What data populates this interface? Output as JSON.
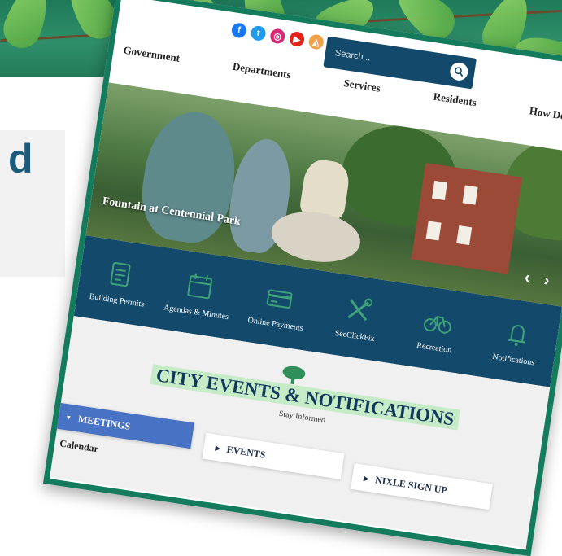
{
  "background": {
    "partial_heading": "d"
  },
  "social": [
    {
      "icon": "facebook-icon",
      "glyph": "f",
      "color": "#1877f2"
    },
    {
      "icon": "twitter-icon",
      "glyph": "t",
      "color": "#1d9bf0"
    },
    {
      "icon": "instagram-icon",
      "glyph": "◎",
      "color": "#d62976"
    },
    {
      "icon": "youtube-icon",
      "glyph": "▶",
      "color": "#e62117"
    },
    {
      "icon": "nixle-icon",
      "glyph": "◭",
      "color": "#f0a24a"
    }
  ],
  "search": {
    "placeholder": "Search..."
  },
  "nav": [
    "Government",
    "Departments",
    "Services",
    "Residents",
    "How Do I..."
  ],
  "hero": {
    "caption": "Fountain at Centennial Park",
    "arrows": "‹ ›"
  },
  "quicklinks": [
    {
      "label": "Building Permits",
      "icon": "permit-icon"
    },
    {
      "label": "Agendas & Minutes",
      "icon": "calendar-icon"
    },
    {
      "label": "Online Payments",
      "icon": "payment-icon"
    },
    {
      "label": "SeeClickFix",
      "icon": "tools-icon"
    },
    {
      "label": "Recreation",
      "icon": "bicycle-icon"
    },
    {
      "label": "Notifications",
      "icon": "notification-icon"
    }
  ],
  "events": {
    "title": "CITY EVENTS & NOTIFICATIONS",
    "subtitle": "Stay Informed",
    "tabs": [
      "MEETINGS",
      "EVENTS",
      "NIXLE SIGN UP"
    ],
    "calendar": "Calendar"
  },
  "colors": {
    "frame": "#147b5c",
    "navy": "#134a6b",
    "active_tab": "#4872c4",
    "title_highlight": "#c6ebc7"
  }
}
